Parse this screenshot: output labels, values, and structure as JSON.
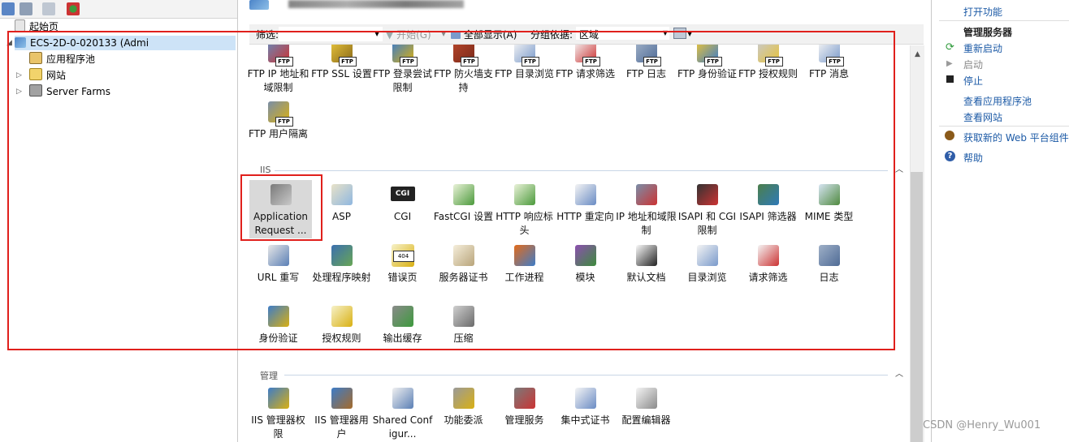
{
  "colors": {
    "annotation_red": "#e0201c",
    "link_blue": "#1c5aa6",
    "selected_bg": "#d9d9d9"
  },
  "connections": {
    "toolbar_icons": [
      "connect-icon",
      "save-icon",
      "up-icon",
      "disconnect-icon"
    ],
    "tree": [
      {
        "label": "起始页",
        "icon": "start-page-icon"
      },
      {
        "label": "ECS-2D-0-020133 (Admi",
        "icon": "server-icon",
        "expanded": true
      },
      {
        "label": "应用程序池",
        "icon": "app-pool-icon"
      },
      {
        "label": "网站",
        "icon": "sites-folder-icon"
      },
      {
        "label": "Server Farms",
        "icon": "server-farms-icon"
      }
    ]
  },
  "filter_bar": {
    "filter_label": "筛选:",
    "start_label": "开始(G)",
    "show_all_label": "全部显示(A)",
    "group_by_label": "分组依据:",
    "group_by_value": "区域"
  },
  "sections": {
    "iis": {
      "title": "IIS"
    },
    "management": {
      "title": "管理"
    }
  },
  "ftp_features": [
    {
      "label": "FTP IP 地址和域限制",
      "icon": "ftp-ip-restrictions-icon"
    },
    {
      "label": "FTP SSL 设置",
      "icon": "ftp-ssl-icon"
    },
    {
      "label": "FTP 登录尝试限制",
      "icon": "ftp-logon-attempts-icon"
    },
    {
      "label": "FTP 防火墙支持",
      "icon": "ftp-firewall-icon"
    },
    {
      "label": "FTP 目录浏览",
      "icon": "ftp-directory-browsing-icon"
    },
    {
      "label": "FTP 请求筛选",
      "icon": "ftp-request-filtering-icon"
    },
    {
      "label": "FTP 日志",
      "icon": "ftp-logging-icon"
    },
    {
      "label": "FTP 身份验证",
      "icon": "ftp-authentication-icon"
    },
    {
      "label": "FTP 授权规则",
      "icon": "ftp-authorization-icon"
    },
    {
      "label": "FTP 消息",
      "icon": "ftp-messages-icon"
    },
    {
      "label": "FTP 用户隔离",
      "icon": "ftp-user-isolation-icon"
    }
  ],
  "iis_features": [
    {
      "label": "Application Request ...",
      "icon": "arr-icon",
      "selected": true
    },
    {
      "label": "ASP",
      "icon": "asp-icon"
    },
    {
      "label": "CGI",
      "icon": "cgi-icon"
    },
    {
      "label": "FastCGI 设置",
      "icon": "fastcgi-icon"
    },
    {
      "label": "HTTP 响应标头",
      "icon": "http-response-headers-icon"
    },
    {
      "label": "HTTP 重定向",
      "icon": "http-redirect-icon"
    },
    {
      "label": "IP 地址和域限制",
      "icon": "ip-restrictions-icon"
    },
    {
      "label": "ISAPI 和 CGI 限制",
      "icon": "isapi-cgi-icon"
    },
    {
      "label": "ISAPI 筛选器",
      "icon": "isapi-filters-icon"
    },
    {
      "label": "MIME 类型",
      "icon": "mime-types-icon"
    },
    {
      "label": "URL 重写",
      "icon": "url-rewrite-icon"
    },
    {
      "label": "处理程序映射",
      "icon": "handler-mappings-icon"
    },
    {
      "label": "错误页",
      "icon": "error-pages-icon"
    },
    {
      "label": "服务器证书",
      "icon": "server-certificates-icon"
    },
    {
      "label": "工作进程",
      "icon": "worker-processes-icon"
    },
    {
      "label": "模块",
      "icon": "modules-icon"
    },
    {
      "label": "默认文档",
      "icon": "default-document-icon"
    },
    {
      "label": "目录浏览",
      "icon": "directory-browsing-icon"
    },
    {
      "label": "请求筛选",
      "icon": "request-filtering-icon"
    },
    {
      "label": "日志",
      "icon": "logging-icon"
    },
    {
      "label": "身份验证",
      "icon": "authentication-icon"
    },
    {
      "label": "授权规则",
      "icon": "authorization-rules-icon"
    },
    {
      "label": "输出缓存",
      "icon": "output-caching-icon"
    },
    {
      "label": "压缩",
      "icon": "compression-icon"
    }
  ],
  "management_features": [
    {
      "label": "IIS 管理器权限",
      "icon": "iis-manager-permissions-icon"
    },
    {
      "label": "IIS 管理器用户",
      "icon": "iis-manager-users-icon"
    },
    {
      "label": "Shared Configur...",
      "icon": "shared-configuration-icon"
    },
    {
      "label": "功能委派",
      "icon": "feature-delegation-icon"
    },
    {
      "label": "管理服务",
      "icon": "management-service-icon"
    },
    {
      "label": "集中式证书",
      "icon": "centralized-certificates-icon"
    },
    {
      "label": "配置编辑器",
      "icon": "configuration-editor-icon"
    }
  ],
  "actions": {
    "open_feature": "打开功能",
    "manage_server_header": "管理服务器",
    "restart": "重新启动",
    "start": "启动",
    "stop": "停止",
    "view_app_pools": "查看应用程序池",
    "view_sites": "查看网站",
    "get_web_platform": "获取新的 Web 平台组件",
    "help": "帮助"
  },
  "watermark": "CSDN @Henry_Wu001"
}
